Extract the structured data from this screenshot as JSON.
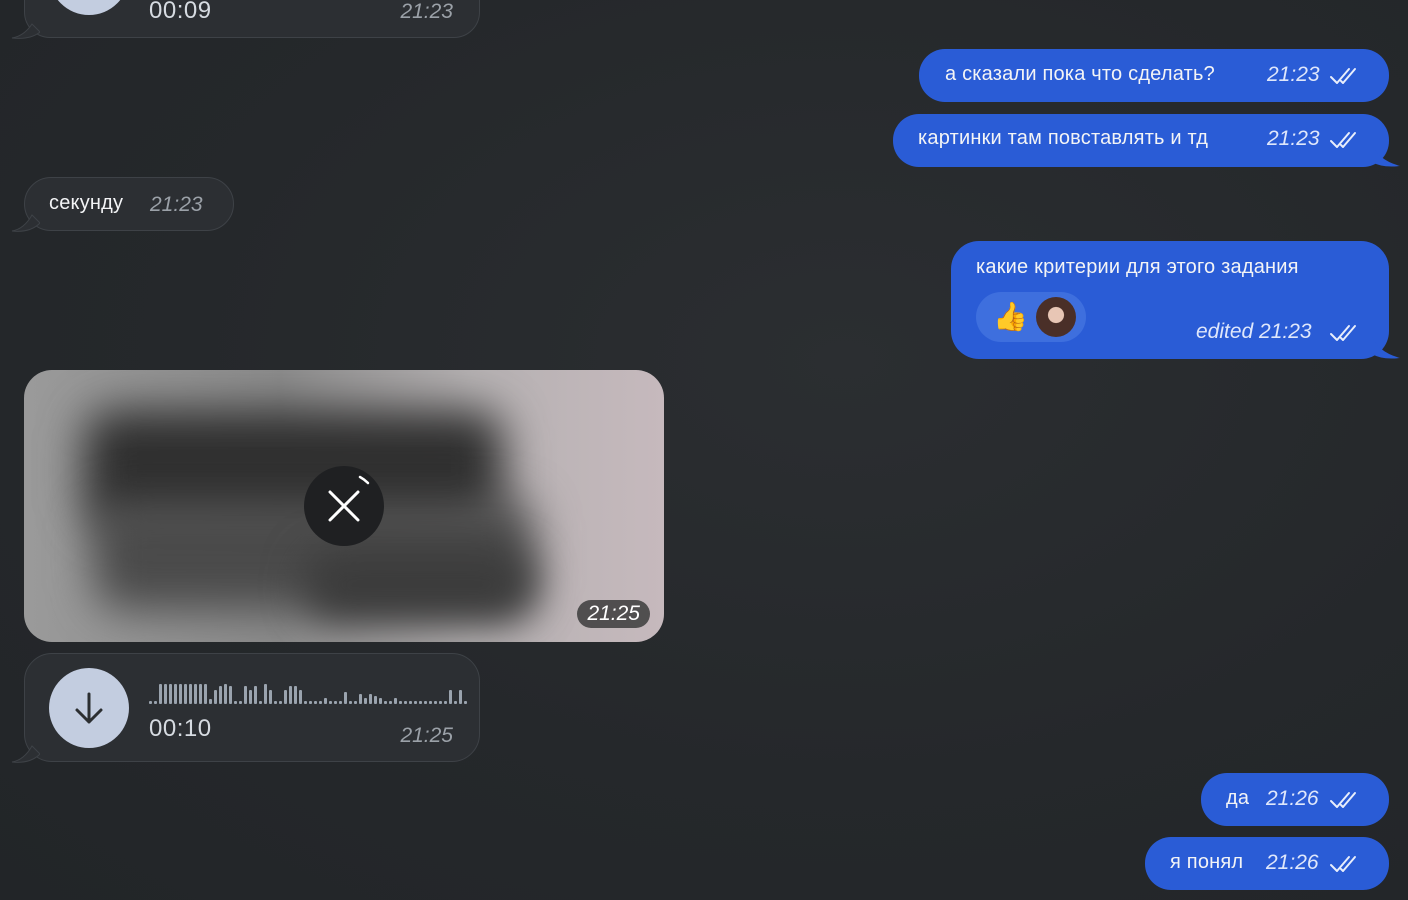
{
  "colors": {
    "incoming_bubble": "#2c2f33",
    "outgoing_bubble": "#2a5cd6",
    "background": "#25282b"
  },
  "messages": {
    "voice_top": {
      "duration": "00:09",
      "time": "21:23"
    },
    "out1": {
      "text": "а сказали пока что сделать?",
      "time": "21:23",
      "status": "read"
    },
    "out2": {
      "text": "картинки там повставлять и тд",
      "time": "21:23",
      "status": "read"
    },
    "in1": {
      "text": "секунду",
      "time": "21:23"
    },
    "out3": {
      "text": "какие критерии для этого задания",
      "time": "edited 21:23",
      "status": "read",
      "reactions": {
        "emoji": "👍",
        "avatar_icon": "avatar-icon"
      }
    },
    "photo": {
      "time": "21:25",
      "state": "downloading",
      "icon": "close-icon"
    },
    "voice": {
      "duration": "00:10",
      "time": "21:25",
      "icon": "download-arrow-icon"
    },
    "out4": {
      "text": "да",
      "time": "21:26",
      "status": "read"
    },
    "out5": {
      "text": "я понял",
      "time": "21:26",
      "status": "read"
    }
  }
}
